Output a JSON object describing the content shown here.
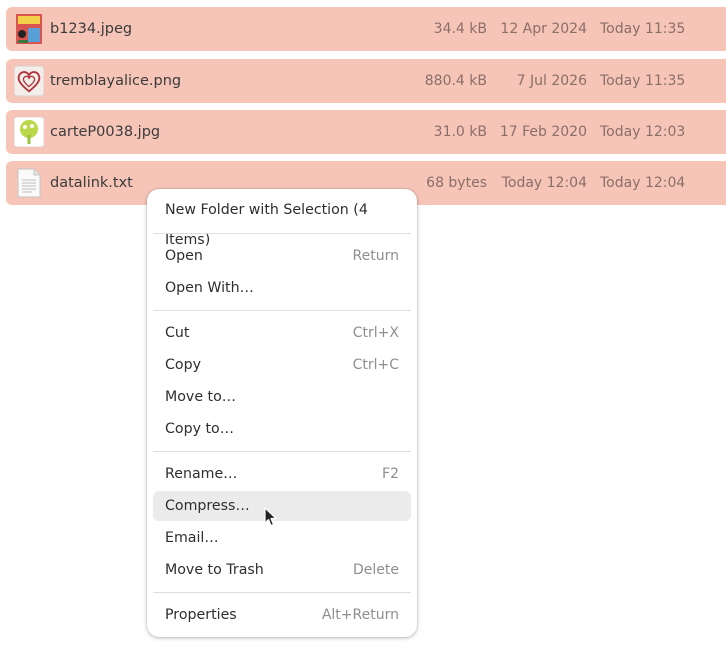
{
  "files": [
    {
      "name": "b1234.jpeg",
      "size": "34.4 kB",
      "modified": "12 Apr 2024",
      "accessed": "Today 11:35",
      "icon": "jpeg-thumbnail-icon"
    },
    {
      "name": "tremblayalice.png",
      "size": "880.4 kB",
      "modified": "7 Jul 2026",
      "accessed": "Today 11:35",
      "icon": "png-heart-thumbnail-icon"
    },
    {
      "name": "carteP0038.jpg",
      "size": "31.0 kB",
      "modified": "17 Feb 2020",
      "accessed": "Today 12:03",
      "icon": "jpg-tree-thumbnail-icon"
    },
    {
      "name": "datalink.txt",
      "size": "68 bytes",
      "modified": "Today 12:04",
      "accessed": "Today 12:04",
      "icon": "text-file-icon"
    }
  ],
  "context_menu": {
    "new_folder": {
      "label": "New Folder with Selection (4 Items)"
    },
    "open": {
      "label": "Open",
      "shortcut": "Return"
    },
    "open_with": {
      "label": "Open With…"
    },
    "cut": {
      "label": "Cut",
      "shortcut": "Ctrl+X"
    },
    "copy": {
      "label": "Copy",
      "shortcut": "Ctrl+C"
    },
    "move_to": {
      "label": "Move to…"
    },
    "copy_to": {
      "label": "Copy to…"
    },
    "rename": {
      "label": "Rename…",
      "shortcut": "F2"
    },
    "compress": {
      "label": "Compress…"
    },
    "email": {
      "label": "Email…"
    },
    "trash": {
      "label": "Move to Trash",
      "shortcut": "Delete"
    },
    "properties": {
      "label": "Properties",
      "shortcut": "Alt+Return"
    },
    "hovered_item": "compress"
  },
  "colors": {
    "selection": "#f6c5b8",
    "menu_hover": "#ebebeb"
  }
}
